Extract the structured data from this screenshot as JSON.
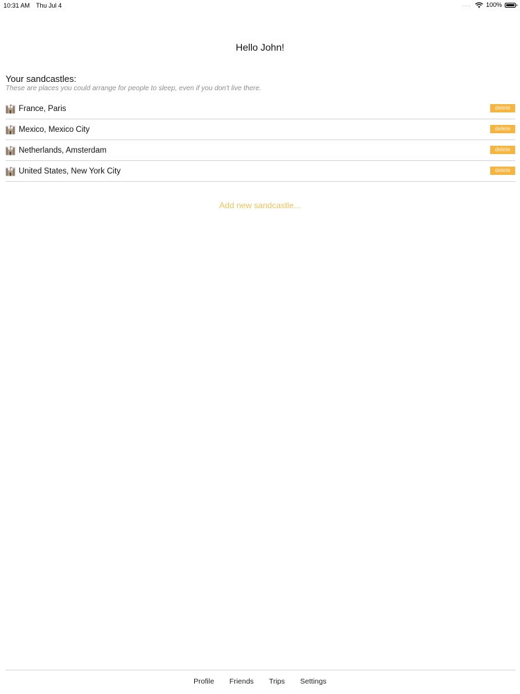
{
  "status_bar": {
    "time": "10:31 AM",
    "date": "Thu Jul 4",
    "signal": ".....",
    "battery": "100%",
    "battery_level": 1.0
  },
  "greeting": "Hello John!",
  "sandcastles": {
    "title": "Your sandcastles:",
    "subtitle": "These are places you could arrange for people to sleep, even if you don't live there.",
    "items": [
      {
        "label": "France, Paris",
        "delete_label": "delete"
      },
      {
        "label": "Mexico, Mexico City",
        "delete_label": "delete"
      },
      {
        "label": "Netherlands, Amsterdam",
        "delete_label": "delete"
      },
      {
        "label": "United States, New York City",
        "delete_label": "delete"
      }
    ],
    "add_label": "Add new sandcastle..."
  },
  "tabs": [
    {
      "label": "Profile"
    },
    {
      "label": "Friends"
    },
    {
      "label": "Trips"
    },
    {
      "label": "Settings"
    }
  ],
  "colors": {
    "accent": "#f7b540",
    "add_link": "#f5c15a",
    "divider": "#d6d6d6",
    "subtitle": "#8e8e8e"
  }
}
